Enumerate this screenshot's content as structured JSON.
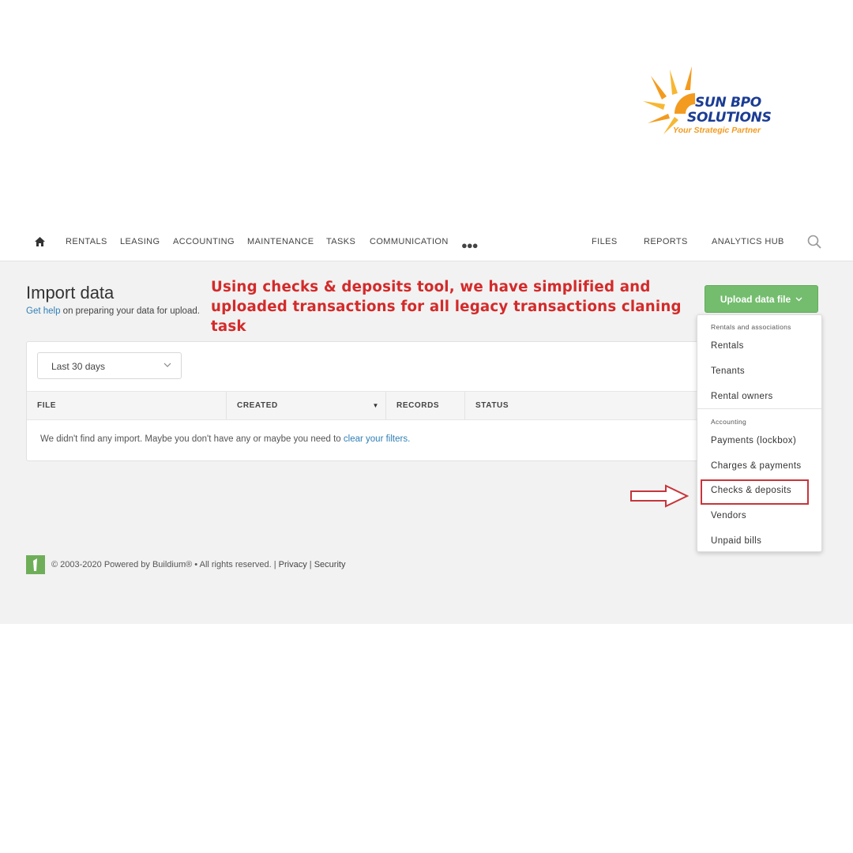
{
  "logo": {
    "line1": "SUN BPO",
    "line2": "SOLUTIONS",
    "tagline": "Your Strategic Partner"
  },
  "nav": {
    "items": [
      "RENTALS",
      "LEASING",
      "ACCOUNTING",
      "MAINTENANCE",
      "TASKS",
      "COMMUNICATION"
    ],
    "right_items": [
      "FILES",
      "REPORTS",
      "ANALYTICS HUB"
    ]
  },
  "page": {
    "title": "Import data",
    "help_link": "Get help",
    "help_rest": " on preparing your data for upload."
  },
  "annotation": "Using checks & deposits tool, we have simplified and uploaded transactions for all legacy transactions claning task",
  "upload_button": {
    "label": "Upload data file"
  },
  "filter": {
    "selected": "Last 30 days"
  },
  "table": {
    "columns": [
      "FILE",
      "CREATED",
      "RECORDS",
      "STATUS"
    ],
    "empty_text": "We didn't find any import. Maybe you don't have any or maybe you need to ",
    "empty_link": "clear your filters."
  },
  "dropdown": {
    "group1": "Rentals and associations",
    "group1_items": [
      "Rentals",
      "Tenants",
      "Rental owners"
    ],
    "group2": "Accounting",
    "group2_items": [
      "Payments (lockbox)",
      "Charges & payments",
      "Checks & deposits",
      "Vendors",
      "Unpaid bills"
    ]
  },
  "footer": {
    "copyright": "© 2003-2020 Powered by Buildium® • All rights reserved. | ",
    "privacy": "Privacy",
    "sep": " | ",
    "security": "Security"
  },
  "colors": {
    "accent_green": "#74bd6e",
    "annotation_red": "#d42a2a",
    "link_blue": "#2f7fb5",
    "logo_orange": "#f39b1f",
    "logo_blue": "#1b3c94"
  }
}
